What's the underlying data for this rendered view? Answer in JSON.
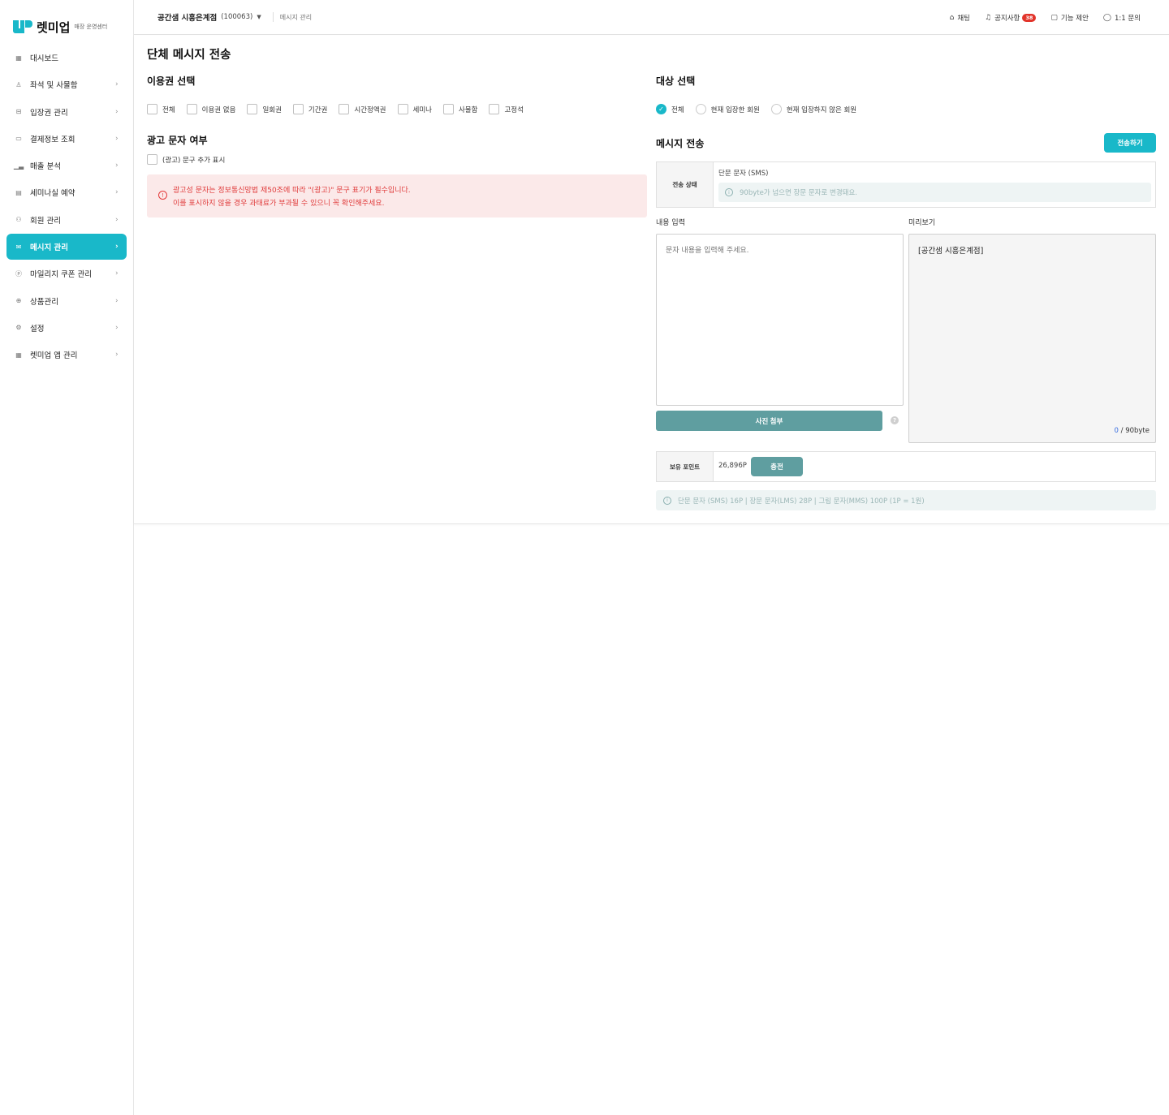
{
  "brand": {
    "name": "렛미업",
    "sub": "매장 운영센터",
    "accent": "#19b8c9"
  },
  "sidebar": {
    "items": [
      {
        "label": "대시보드",
        "icon": "grid-icon",
        "chevron": false
      },
      {
        "label": "좌석 및 사물함",
        "icon": "seat-icon",
        "chevron": true
      },
      {
        "label": "입장권 관리",
        "icon": "ticket-icon",
        "chevron": true
      },
      {
        "label": "결제정보 조회",
        "icon": "card-icon",
        "chevron": true
      },
      {
        "label": "매출 분석",
        "icon": "chart-icon",
        "chevron": true
      },
      {
        "label": "세미나실 예약",
        "icon": "calendar-icon",
        "chevron": true
      },
      {
        "label": "회원 관리",
        "icon": "users-icon",
        "chevron": true
      },
      {
        "label": "메시지 관리",
        "icon": "mail-icon",
        "chevron": true,
        "active": true
      },
      {
        "label": "마일리지 쿠폰 관리",
        "icon": "coin-icon",
        "chevron": true
      },
      {
        "label": "상품관리",
        "icon": "bag-icon",
        "chevron": true
      },
      {
        "label": "설정",
        "icon": "gear-icon",
        "chevron": true
      },
      {
        "label": "렛미업 앱 관리",
        "icon": "apps-icon",
        "chevron": true
      }
    ]
  },
  "header": {
    "store": "공간샘 시흥은계점",
    "store_code": "(100063)",
    "breadcrumb": "메시지 관리",
    "links": {
      "chat": "채팅",
      "notice": "공지사항",
      "notice_badge": "38",
      "suggest": "기능 제안",
      "inquiry": "1:1 문의"
    }
  },
  "page": {
    "title": "단체 메시지 전송",
    "ticket_section": {
      "title": "이용권 선택",
      "options": [
        "전체",
        "이용권 없음",
        "일회권",
        "기간권",
        "시간정액권",
        "세미나",
        "사물함",
        "고정석"
      ]
    },
    "ad_section": {
      "title": "광고 문자 여부",
      "checkbox_label": "(광고) 문구 추가 표시",
      "warning_line1": "광고성 문자는 정보통신망법 제50조에 따라 \"(광고)\" 문구 표기가 필수입니다.",
      "warning_line2": "이를 표시하지 않을 경우 과태료가 부과될 수 있으니 꼭 확인해주세요."
    },
    "target_section": {
      "title": "대상 선택",
      "options": [
        "전체",
        "현재 입장한 회원",
        "현재 입장하지 않은 회원"
      ],
      "selected": "전체"
    },
    "message_section": {
      "title": "메시지 전송",
      "send_button": "전송하기",
      "status_label": "전송 상태",
      "sms_type": "단문 문자 (SMS)",
      "sms_info": "90byte가 넘으면 장문 문자로 변경돼요.",
      "content_label": "내용 입력",
      "content_placeholder": "문자 내용을 입력해 주세요.",
      "preview_label": "미리보기",
      "preview_text": "[공간샘 시흥은계점]",
      "byte_current": "0",
      "byte_max": " / 90byte",
      "photo_button": "사진 첨부",
      "points_label": "보유 포인트",
      "points_value": "26,896P",
      "charge_button": "충전",
      "pricing_info": "단문 문자 (SMS) 16P | 장문 문자(LMS) 28P | 그림 문자(MMS) 100P (1P = 1원)"
    }
  }
}
